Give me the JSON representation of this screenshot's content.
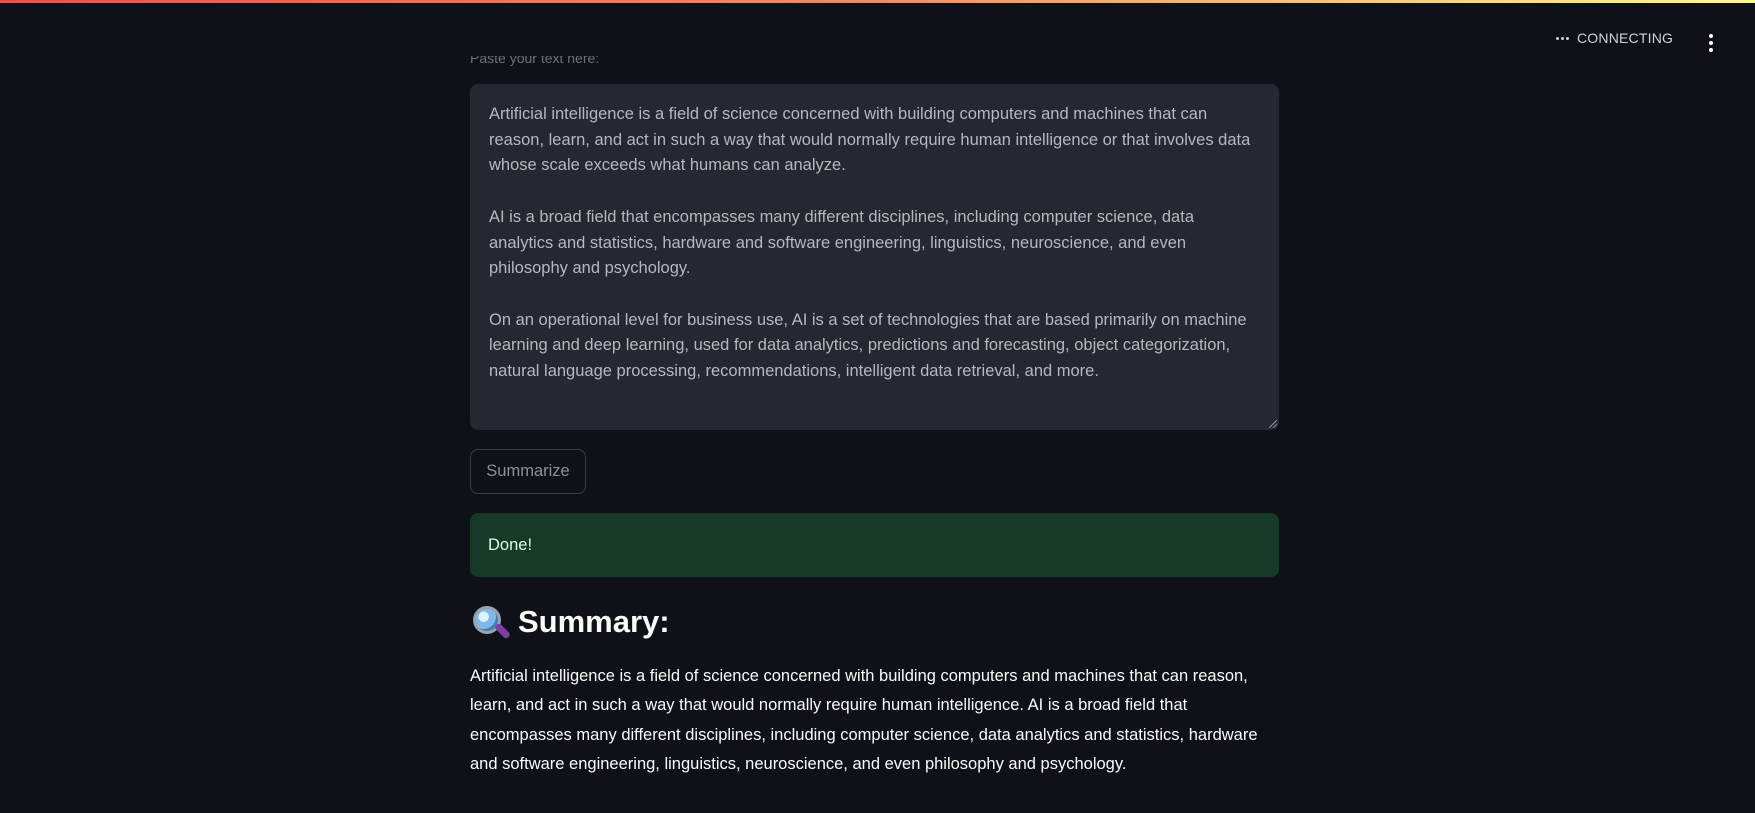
{
  "header": {
    "status_text": "CONNECTING",
    "status_icon": "ellipsis-icon",
    "menu_icon": "vertical-dots-icon"
  },
  "input": {
    "label": "Paste your text here:",
    "paragraphs": [
      "Artificial intelligence is a field of science concerned with building computers and machines that can reason, learn, and act in such a way that would normally require human intelligence or that involves data whose scale exceeds what humans can analyze.",
      "AI is a broad field that encompasses many different disciplines, including computer science, data analytics and statistics, hardware and software engineering, linguistics, neuroscience, and even philosophy and psychology.",
      "On an operational level for business use, AI is a set of technologies that are based primarily on machine learning and deep learning, used for data analytics, predictions and forecasting, object categorization, natural language processing, recommendations, intelligent data retrieval, and more."
    ]
  },
  "actions": {
    "summarize_label": "Summarize"
  },
  "alert": {
    "message": "Done!",
    "color": "#173928"
  },
  "summary": {
    "heading": "Summary:",
    "heading_icon": "magnifying-glass-icon",
    "text": "Artificial intelligence is a field of science concerned with building computers and machines that can reason, learn, and act in such a way that would normally require human intelligence. AI is a broad field that encompasses many different disciplines, including computer science, data analytics and statistics, hardware and software engineering, linguistics, neuroscience, and even philosophy and psychology."
  },
  "theme": {
    "background": "#0e1117",
    "input_background": "#262730",
    "accent_gradient": [
      "#ff4b4b",
      "#fffd80"
    ]
  }
}
